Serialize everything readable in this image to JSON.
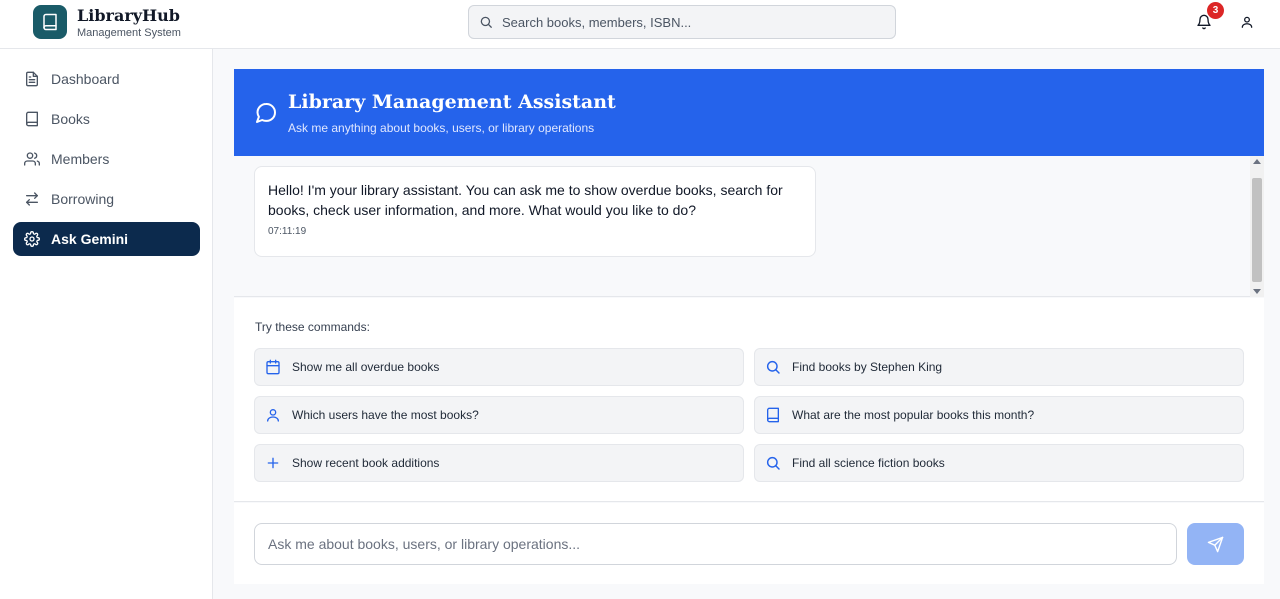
{
  "app": {
    "name": "LibraryHub",
    "subtitle": "Management System"
  },
  "header": {
    "search_placeholder": "Search books, members, ISBN...",
    "notification_count": "3"
  },
  "sidebar": {
    "items": [
      {
        "label": "Dashboard",
        "icon": "document-icon",
        "active": false
      },
      {
        "label": "Books",
        "icon": "book-icon",
        "active": false
      },
      {
        "label": "Members",
        "icon": "users-icon",
        "active": false
      },
      {
        "label": "Borrowing",
        "icon": "arrows-icon",
        "active": false
      },
      {
        "label": "Ask Gemini",
        "icon": "gear-icon",
        "active": true
      }
    ]
  },
  "chat": {
    "title": "Library Management Assistant",
    "subtitle": "Ask me anything about books, users, or library operations",
    "messages": [
      {
        "text": "Hello! I'm your library assistant. You can ask me to show overdue books, search for books, check user information, and more. What would you like to do?",
        "time": "07:11:19"
      }
    ]
  },
  "commands": {
    "label": "Try these commands:",
    "items": [
      {
        "text": "Show me all overdue books",
        "icon": "calendar-icon"
      },
      {
        "text": "Find books by Stephen King",
        "icon": "search-icon"
      },
      {
        "text": "Which users have the most books?",
        "icon": "user-icon"
      },
      {
        "text": "What are the most popular books this month?",
        "icon": "book-icon"
      },
      {
        "text": "Show recent book additions",
        "icon": "plus-icon"
      },
      {
        "text": "Find all science fiction books",
        "icon": "search-icon"
      }
    ]
  },
  "composer": {
    "placeholder": "Ask me about books, users, or library operations..."
  },
  "colors": {
    "primary": "#2563eb",
    "nav_active": "#0c2a4d",
    "logo": "#1a5b68",
    "badge": "#dc2626",
    "send": "#93b4f5"
  }
}
